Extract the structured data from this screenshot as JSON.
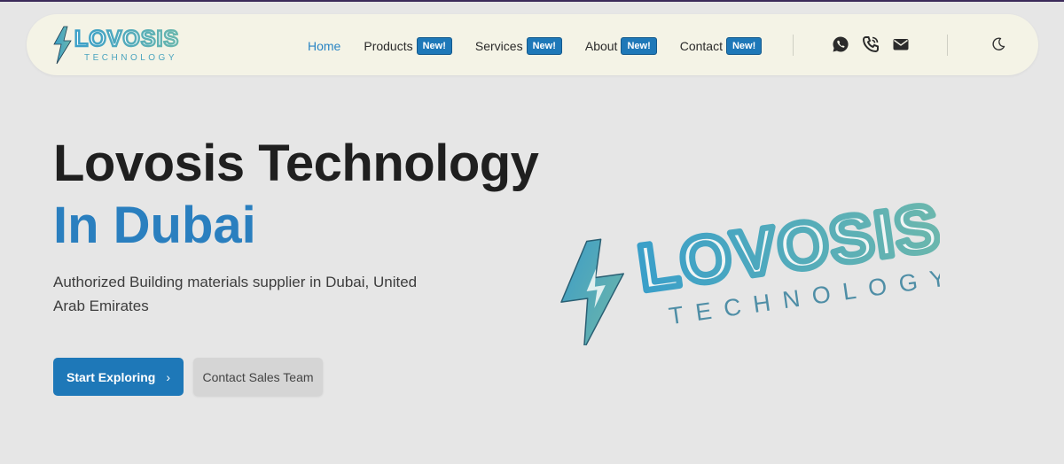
{
  "brand": {
    "name": "LOVOSIS",
    "tagline": "TECHNOLOGY",
    "colors": {
      "gradient_start": "#3a9fc9",
      "gradient_end": "#6bb7ad",
      "outline": "#1f3f53"
    }
  },
  "nav": {
    "items": [
      {
        "label": "Home",
        "active": true
      },
      {
        "label": "Products",
        "badge": "New!"
      },
      {
        "label": "Services",
        "badge": "New!"
      },
      {
        "label": "About",
        "badge": "New!"
      },
      {
        "label": "Contact",
        "badge": "New!"
      }
    ],
    "icons": [
      "whatsapp-icon",
      "phone-icon",
      "mail-icon",
      "moon-icon"
    ]
  },
  "hero": {
    "title": "Lovosis Technology",
    "title_accent": "In Dubai",
    "subtitle": "Authorized Building materials supplier in Dubai, United Arab Emirates",
    "primary_button": "Start Exploring",
    "primary_button_icon": "chevron-right-icon",
    "secondary_button": "Contact Sales Team"
  },
  "colors": {
    "accent": "#2a7fbf",
    "button": "#1e78b8",
    "navbar_bg": "#f4f3e6",
    "page_bg": "#e6e6e6"
  }
}
